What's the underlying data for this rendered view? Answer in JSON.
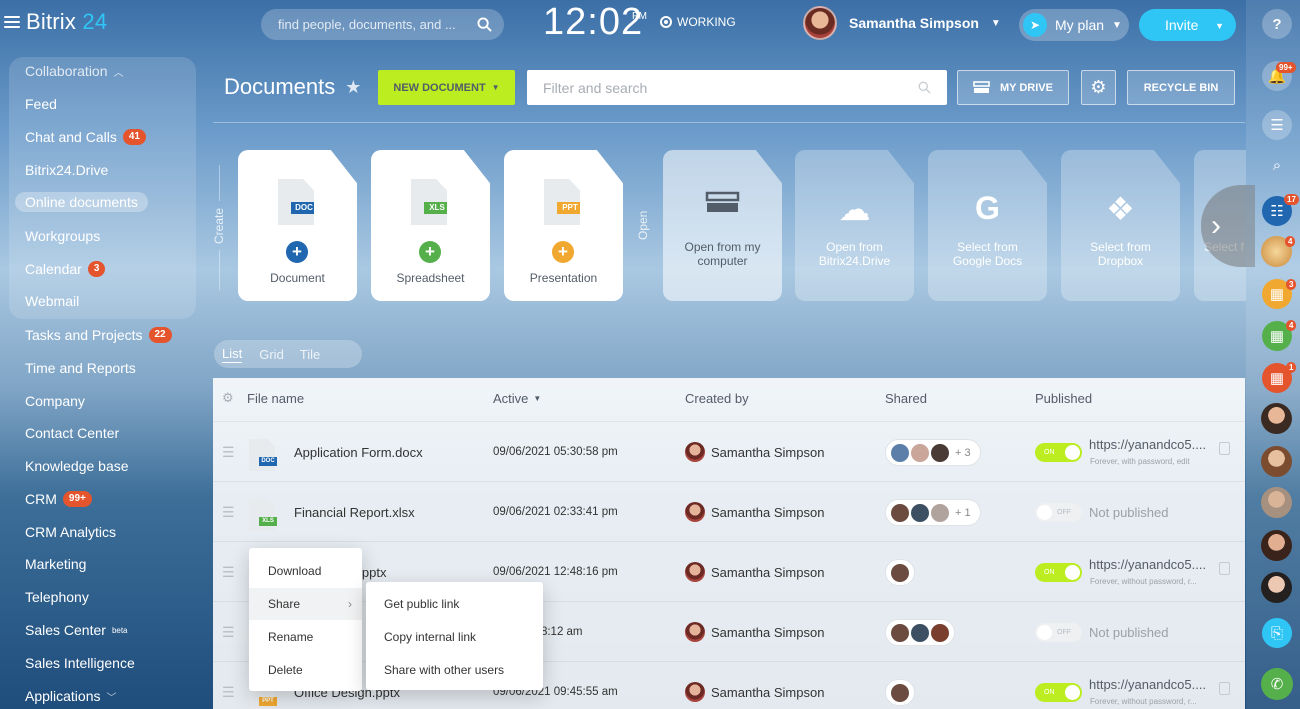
{
  "header": {
    "logo_main": "Bitrix",
    "logo_num": "24",
    "search_placeholder": "find people, documents, and ...",
    "clock": "12:02",
    "ampm": "PM",
    "status": "WORKING",
    "user_name": "Samantha Simpson",
    "plan_label": "My plan",
    "invite_label": "Invite",
    "help": "?"
  },
  "sidebar": {
    "section_label": "Collaboration",
    "items": [
      {
        "label": "Feed",
        "badge": ""
      },
      {
        "label": "Chat and Calls",
        "badge": "41"
      },
      {
        "label": "Bitrix24.Drive",
        "badge": ""
      },
      {
        "label": "Online documents",
        "badge": ""
      },
      {
        "label": "Workgroups",
        "badge": ""
      },
      {
        "label": "Calendar",
        "badge": "3"
      },
      {
        "label": "Webmail",
        "badge": ""
      },
      {
        "label": "Tasks and Projects",
        "badge": "22"
      },
      {
        "label": "Time and Reports",
        "badge": ""
      },
      {
        "label": "Company",
        "badge": ""
      },
      {
        "label": "Contact Center",
        "badge": ""
      },
      {
        "label": "Knowledge base",
        "badge": ""
      },
      {
        "label": "CRM",
        "badge": "99+"
      },
      {
        "label": "CRM Analytics",
        "badge": ""
      },
      {
        "label": "Marketing",
        "badge": ""
      },
      {
        "label": "Telephony",
        "badge": ""
      },
      {
        "label": "Sales Center",
        "badge": "",
        "sup": "beta"
      },
      {
        "label": "Sales Intelligence",
        "badge": ""
      },
      {
        "label": "Applications",
        "badge": ""
      }
    ]
  },
  "documents": {
    "title": "Documents",
    "new_document": "NEW DOCUMENT",
    "filter_placeholder": "Filter and search",
    "my_drive": "MY DRIVE",
    "recycle_bin": "RECYCLE BIN",
    "create_label": "Create",
    "open_label": "Open"
  },
  "create_cards": [
    {
      "tag": "DOC",
      "label": "Document",
      "color": "#2067b0"
    },
    {
      "tag": "XLS",
      "label": "Spreadsheet",
      "color": "#55b04b"
    },
    {
      "tag": "PPT",
      "label": "Presentation",
      "color": "#f0a830"
    }
  ],
  "open_cards": [
    {
      "icon": "hard-drive-icon",
      "label_1": "Open from my",
      "label_2": "computer"
    },
    {
      "icon": "cloud-upload-icon",
      "label_1": "Open from",
      "label_2": "Bitrix24.Drive"
    },
    {
      "icon": "google-icon",
      "label_1": "Select from",
      "label_2": "Google Docs"
    },
    {
      "icon": "dropbox-icon",
      "label_1": "Select from",
      "label_2": "Dropbox"
    },
    {
      "icon": "more-icon",
      "label_1": "Select f",
      "label_2": ""
    }
  ],
  "view_tabs": [
    "List",
    "Grid",
    "Tile"
  ],
  "table": {
    "columns": [
      "File name",
      "Active",
      "Created by",
      "Shared",
      "Published"
    ],
    "rows": [
      {
        "tag": "DOC",
        "tag_color": "#2067b0",
        "name": "Application Form.docx",
        "date": "09/06/2021 05:30:58 pm",
        "creator": "Samantha Simpson",
        "shared_extra": "+ 3",
        "published": true,
        "link": "https://yanandco5....",
        "link_note": "Forever, with password, edit"
      },
      {
        "tag": "XLS",
        "tag_color": "#55b04b",
        "name": "Financial Report.xlsx",
        "date": "09/06/2021 02:33:41 pm",
        "creator": "Samantha Simpson",
        "shared_extra": "+ 1",
        "published": false,
        "status": "Not published"
      },
      {
        "tag": "PPT",
        "tag_color": "#f0a830",
        "name": "...gn.pptx",
        "date": "09/06/2021 12:48:16 pm",
        "creator": "Samantha Simpson",
        "shared_extra": "",
        "published": true,
        "link": "https://yanandco5....",
        "link_note": "Forever, without password, r..."
      },
      {
        "tag": "",
        "tag_color": "#9aa1a9",
        "name": "",
        "date": "...21 10:48:12 am",
        "creator": "Samantha Simpson",
        "shared_extra": "",
        "published": false,
        "status": "Not published"
      },
      {
        "tag": "PPT",
        "tag_color": "#f0a830",
        "name": "Office Design.pptx",
        "date": "09/06/2021 09:45:55 am",
        "creator": "Samantha Simpson",
        "shared_extra": "",
        "published": true,
        "link": "https://yanandco5....",
        "link_note": "Forever, without password, r..."
      }
    ],
    "toggle_on": "ON",
    "toggle_off": "OFF"
  },
  "context_menu": {
    "items": [
      "Download",
      "Share",
      "Rename",
      "Delete"
    ],
    "share_submenu": [
      "Get public link",
      "Copy internal link",
      "Share with other users"
    ]
  },
  "right_rail": {
    "notifications_badge": "99+",
    "badges": [
      "17",
      "4",
      "3",
      "4",
      "1"
    ]
  },
  "colors": {
    "accent": "#2fc6f6",
    "new_doc_green": "#bbed21",
    "badge_red": "#e4542d"
  }
}
